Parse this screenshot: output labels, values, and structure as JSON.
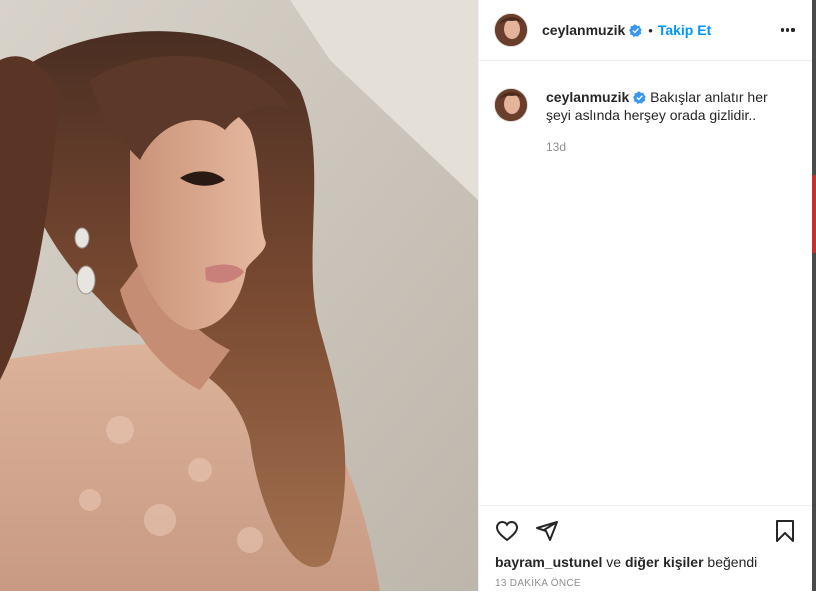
{
  "post": {
    "username": "ceylanmuzik",
    "dot": "•",
    "follow_label": "Takip Et",
    "caption_username": "ceylanmuzik",
    "caption_text": "Bakışlar anlatır her şeyi aslında herşey orada gizlidir..",
    "caption_age": "13d",
    "likes": {
      "liker": "bayram_ustunel",
      "connector": " ve ",
      "others": "diğer kişiler",
      "suffix": " beğendi"
    },
    "timestamp": "13 DAKİKA ÖNCE"
  },
  "icons": {
    "more": "more-options-icon",
    "verified": "verified-badge-icon",
    "like": "heart-icon",
    "share": "paper-plane-icon",
    "save": "bookmark-icon"
  },
  "colors": {
    "link_blue": "#0095f6",
    "verified_blue": "#3897f0",
    "text": "#262626",
    "muted": "#8e8e8e"
  }
}
